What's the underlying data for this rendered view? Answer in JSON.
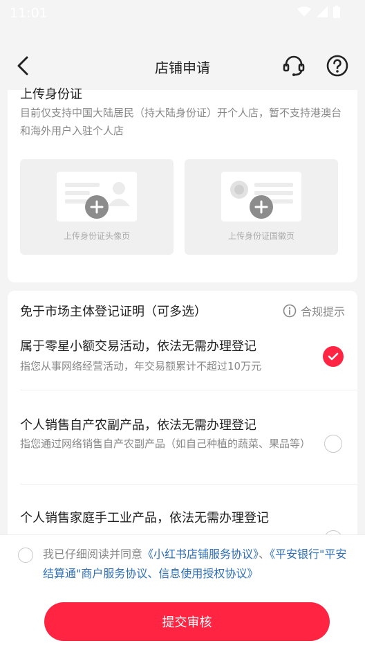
{
  "status_bar": {
    "time": "11:01"
  },
  "nav": {
    "title": "店铺申请"
  },
  "id_section": {
    "title": "上传身份证",
    "description": "目前仅支持中国大陆居民（持大陆身份证）开个人店，暂不支持港澳台和海外用户入驻个人店",
    "front_label": "上传身份证头像页",
    "back_label": "上传身份证国徽页"
  },
  "exempt_section": {
    "title": "免于市场主体登记证明（可多选）",
    "compliance_label": "合规提示",
    "options": [
      {
        "title": "属于零星小额交易活动，依法无需办理登记",
        "desc": "指您从事网络经营活动，年交易额累计不超过10万元",
        "checked": true
      },
      {
        "title": "个人销售自产农副产品，依法无需办理登记",
        "desc": "指您通过网络销售自产农副产品（如自己种植的蔬菜、果品等）",
        "checked": false
      },
      {
        "title": "个人销售家庭手工业产品，依法无需办理登记",
        "desc": "",
        "checked": false
      }
    ]
  },
  "agreement": {
    "prefix": "我已仔细阅读并同意",
    "link1": "《小红书店铺服务协议》",
    "separator": "、",
    "link2": "《平安银行\"平安结算通\"商户服务协议、信息使用授权协议》"
  },
  "submit_label": "提交审核",
  "colors": {
    "accent": "#ff2442",
    "link": "#2f6fb5"
  }
}
